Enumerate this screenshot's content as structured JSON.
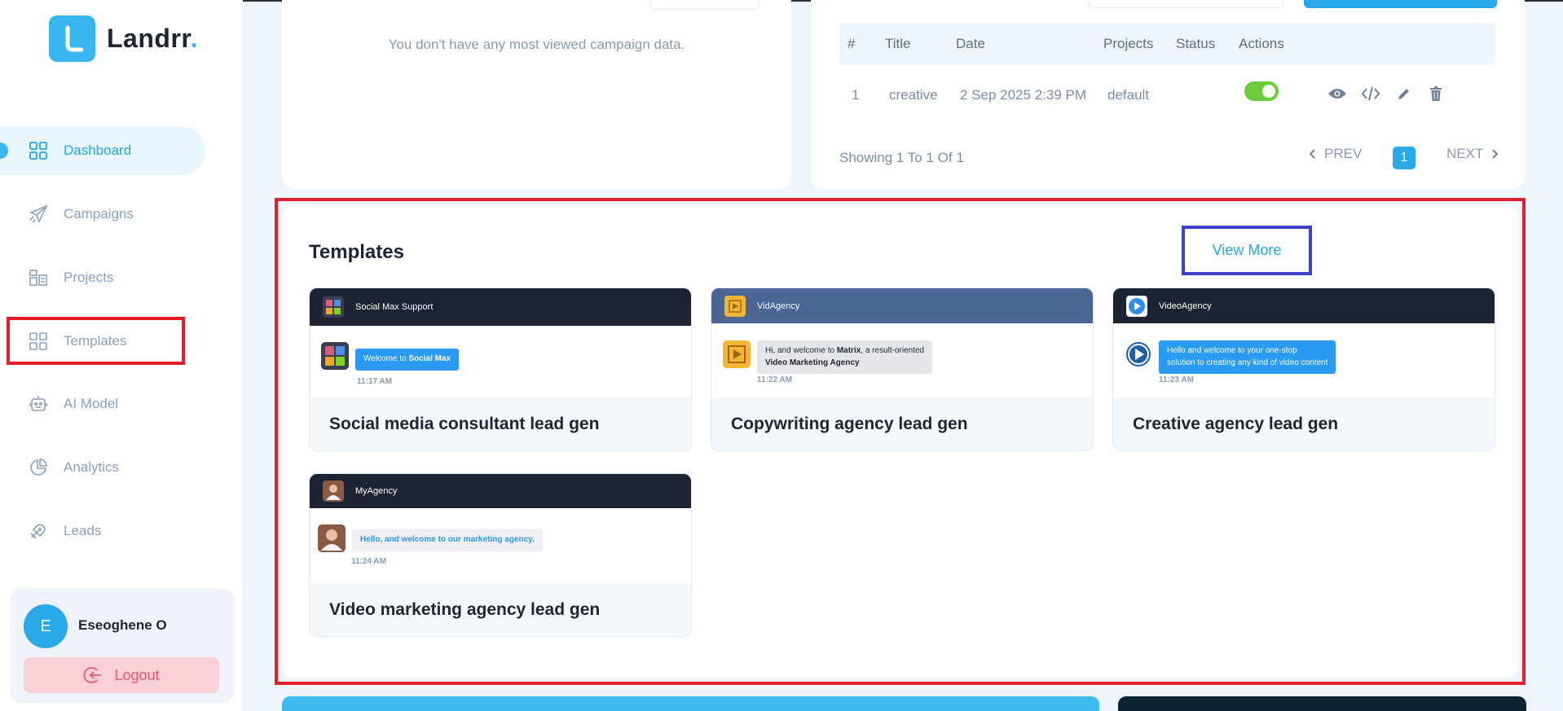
{
  "brand": {
    "name": "Landrr",
    "dot": "."
  },
  "sidebar": {
    "items": [
      {
        "label": "Dashboard",
        "icon": "grid-icon",
        "active": true
      },
      {
        "label": "Campaigns",
        "icon": "paper-plane-icon"
      },
      {
        "label": "Projects",
        "icon": "projects-icon"
      },
      {
        "label": "Templates",
        "icon": "templates-icon"
      },
      {
        "label": "AI Model",
        "icon": "robot-icon"
      },
      {
        "label": "Analytics",
        "icon": "pie-chart-icon"
      },
      {
        "label": "Leads",
        "icon": "leads-icon"
      }
    ],
    "user": {
      "initial": "E",
      "name": "Eseoghene O"
    },
    "logout_label": "Logout"
  },
  "most_viewed": {
    "empty_message": "You don't have any most viewed campaign data."
  },
  "campaigns_table": {
    "headers": [
      "#",
      "Title",
      "Date",
      "Projects",
      "Status",
      "Actions"
    ],
    "rows": [
      {
        "index": "1",
        "title": "creative",
        "date": "2 Sep 2025 2:39 PM",
        "project": "default",
        "status_on": true
      }
    ],
    "actions": [
      "eye-icon",
      "code-icon",
      "pencil-icon",
      "trash-icon"
    ],
    "showing": "Showing 1 To 1 Of 1",
    "prev_label": "PREV",
    "next_label": "NEXT",
    "current_page": "1"
  },
  "templates": {
    "title": "Templates",
    "view_more": "View More",
    "cards": [
      {
        "name": "Social media consultant lead gen",
        "header_title": "Social Max Support",
        "message_prefix": "Welcome to ",
        "message_bold": "Social Max",
        "time": "11:17 AM"
      },
      {
        "name": "Copywriting agency lead gen",
        "header_title": "VidAgency",
        "message_line1_a": "Hi, and welcome to ",
        "message_line1_bold": "Matrix",
        "message_line1_b": ", a result-oriented",
        "message_line2": "Video Marketing Agency",
        "time": "11:22 AM"
      },
      {
        "name": "Creative agency lead gen",
        "header_title": "VideoAgency",
        "message_line1": "Hello and welcome to your one-stop",
        "message_line2": "solution to creating any kind of video content",
        "time": "11:23 AM"
      },
      {
        "name": "Video marketing agency lead gen",
        "header_title": "MyAgency",
        "message": "Hello, and welcome to our marketing agency.",
        "time": "11:24 AM"
      }
    ]
  },
  "colors": {
    "accent": "#2aa9e8",
    "highlight_red": "#e2202c",
    "highlight_blue": "#3b44c9",
    "toggle_on": "#6ccc3a"
  }
}
